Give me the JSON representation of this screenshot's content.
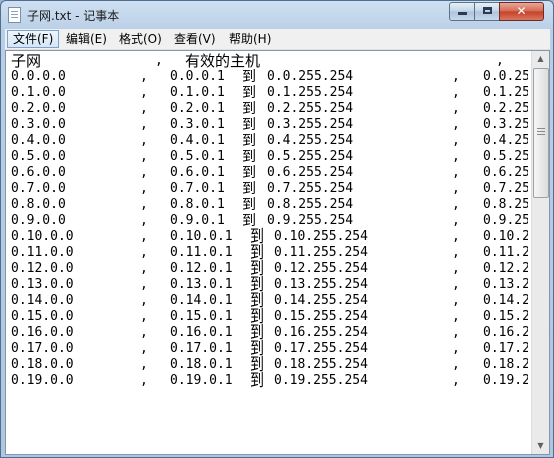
{
  "window": {
    "title": "子网.txt - 记事本",
    "close_glyph": "✕",
    "icon": "notepad-icon"
  },
  "menu": [
    {
      "label": "文件(F)",
      "active": true
    },
    {
      "label": "编辑(E)",
      "active": false
    },
    {
      "label": "格式(O)",
      "active": false
    },
    {
      "label": "查看(V)",
      "active": false
    },
    {
      "label": "帮助(H)",
      "active": false
    }
  ],
  "document": {
    "header": {
      "subnet": "子网",
      "sep1": ",",
      "hosts": "有效的主机",
      "sep2": ","
    },
    "rows": [
      {
        "subnet": "0.0.0.0",
        "sep1": ",",
        "start": "0.0.0.1",
        "to": "到",
        "end": "0.0.255.254",
        "sep2": ",",
        "broadcast": "0.0.25"
      },
      {
        "subnet": "0.1.0.0",
        "sep1": ",",
        "start": "0.1.0.1",
        "to": "到",
        "end": "0.1.255.254",
        "sep2": ",",
        "broadcast": "0.1.25"
      },
      {
        "subnet": "0.2.0.0",
        "sep1": ",",
        "start": "0.2.0.1",
        "to": "到",
        "end": "0.2.255.254",
        "sep2": ",",
        "broadcast": "0.2.25"
      },
      {
        "subnet": "0.3.0.0",
        "sep1": ",",
        "start": "0.3.0.1",
        "to": "到",
        "end": "0.3.255.254",
        "sep2": ",",
        "broadcast": "0.3.25"
      },
      {
        "subnet": "0.4.0.0",
        "sep1": ",",
        "start": "0.4.0.1",
        "to": "到",
        "end": "0.4.255.254",
        "sep2": ",",
        "broadcast": "0.4.25"
      },
      {
        "subnet": "0.5.0.0",
        "sep1": ",",
        "start": "0.5.0.1",
        "to": "到",
        "end": "0.5.255.254",
        "sep2": ",",
        "broadcast": "0.5.25"
      },
      {
        "subnet": "0.6.0.0",
        "sep1": ",",
        "start": "0.6.0.1",
        "to": "到",
        "end": "0.6.255.254",
        "sep2": ",",
        "broadcast": "0.6.25"
      },
      {
        "subnet": "0.7.0.0",
        "sep1": ",",
        "start": "0.7.0.1",
        "to": "到",
        "end": "0.7.255.254",
        "sep2": ",",
        "broadcast": "0.7.25"
      },
      {
        "subnet": "0.8.0.0",
        "sep1": ",",
        "start": "0.8.0.1",
        "to": "到",
        "end": "0.8.255.254",
        "sep2": ",",
        "broadcast": "0.8.25"
      },
      {
        "subnet": "0.9.0.0",
        "sep1": ",",
        "start": "0.9.0.1",
        "to": "到",
        "end": "0.9.255.254",
        "sep2": ",",
        "broadcast": "0.9.25"
      },
      {
        "subnet": "0.10.0.0",
        "sep1": ",",
        "start": "0.10.0.1",
        "to": "到",
        "end": "0.10.255.254",
        "sep2": ",",
        "broadcast": "0.10.2"
      },
      {
        "subnet": "0.11.0.0",
        "sep1": ",",
        "start": "0.11.0.1",
        "to": "到",
        "end": "0.11.255.254",
        "sep2": ",",
        "broadcast": "0.11.2"
      },
      {
        "subnet": "0.12.0.0",
        "sep1": ",",
        "start": "0.12.0.1",
        "to": "到",
        "end": "0.12.255.254",
        "sep2": ",",
        "broadcast": "0.12.2"
      },
      {
        "subnet": "0.13.0.0",
        "sep1": ",",
        "start": "0.13.0.1",
        "to": "到",
        "end": "0.13.255.254",
        "sep2": ",",
        "broadcast": "0.13.2"
      },
      {
        "subnet": "0.14.0.0",
        "sep1": ",",
        "start": "0.14.0.1",
        "to": "到",
        "end": "0.14.255.254",
        "sep2": ",",
        "broadcast": "0.14.2"
      },
      {
        "subnet": "0.15.0.0",
        "sep1": ",",
        "start": "0.15.0.1",
        "to": "到",
        "end": "0.15.255.254",
        "sep2": ",",
        "broadcast": "0.15.2"
      },
      {
        "subnet": "0.16.0.0",
        "sep1": ",",
        "start": "0.16.0.1",
        "to": "到",
        "end": "0.16.255.254",
        "sep2": ",",
        "broadcast": "0.16.2"
      },
      {
        "subnet": "0.17.0.0",
        "sep1": ",",
        "start": "0.17.0.1",
        "to": "到",
        "end": "0.17.255.254",
        "sep2": ",",
        "broadcast": "0.17.2"
      },
      {
        "subnet": "0.18.0.0",
        "sep1": ",",
        "start": "0.18.0.1",
        "to": "到",
        "end": "0.18.255.254",
        "sep2": ",",
        "broadcast": "0.18.2"
      },
      {
        "subnet": "0.19.0.0",
        "sep1": ",",
        "start": "0.19.0.1",
        "to": "到",
        "end": "0.19.255.254",
        "sep2": ",",
        "broadcast": "0.19.2"
      }
    ]
  },
  "scrollbar": {
    "up_arrow": "▲",
    "down_arrow": "▼"
  }
}
